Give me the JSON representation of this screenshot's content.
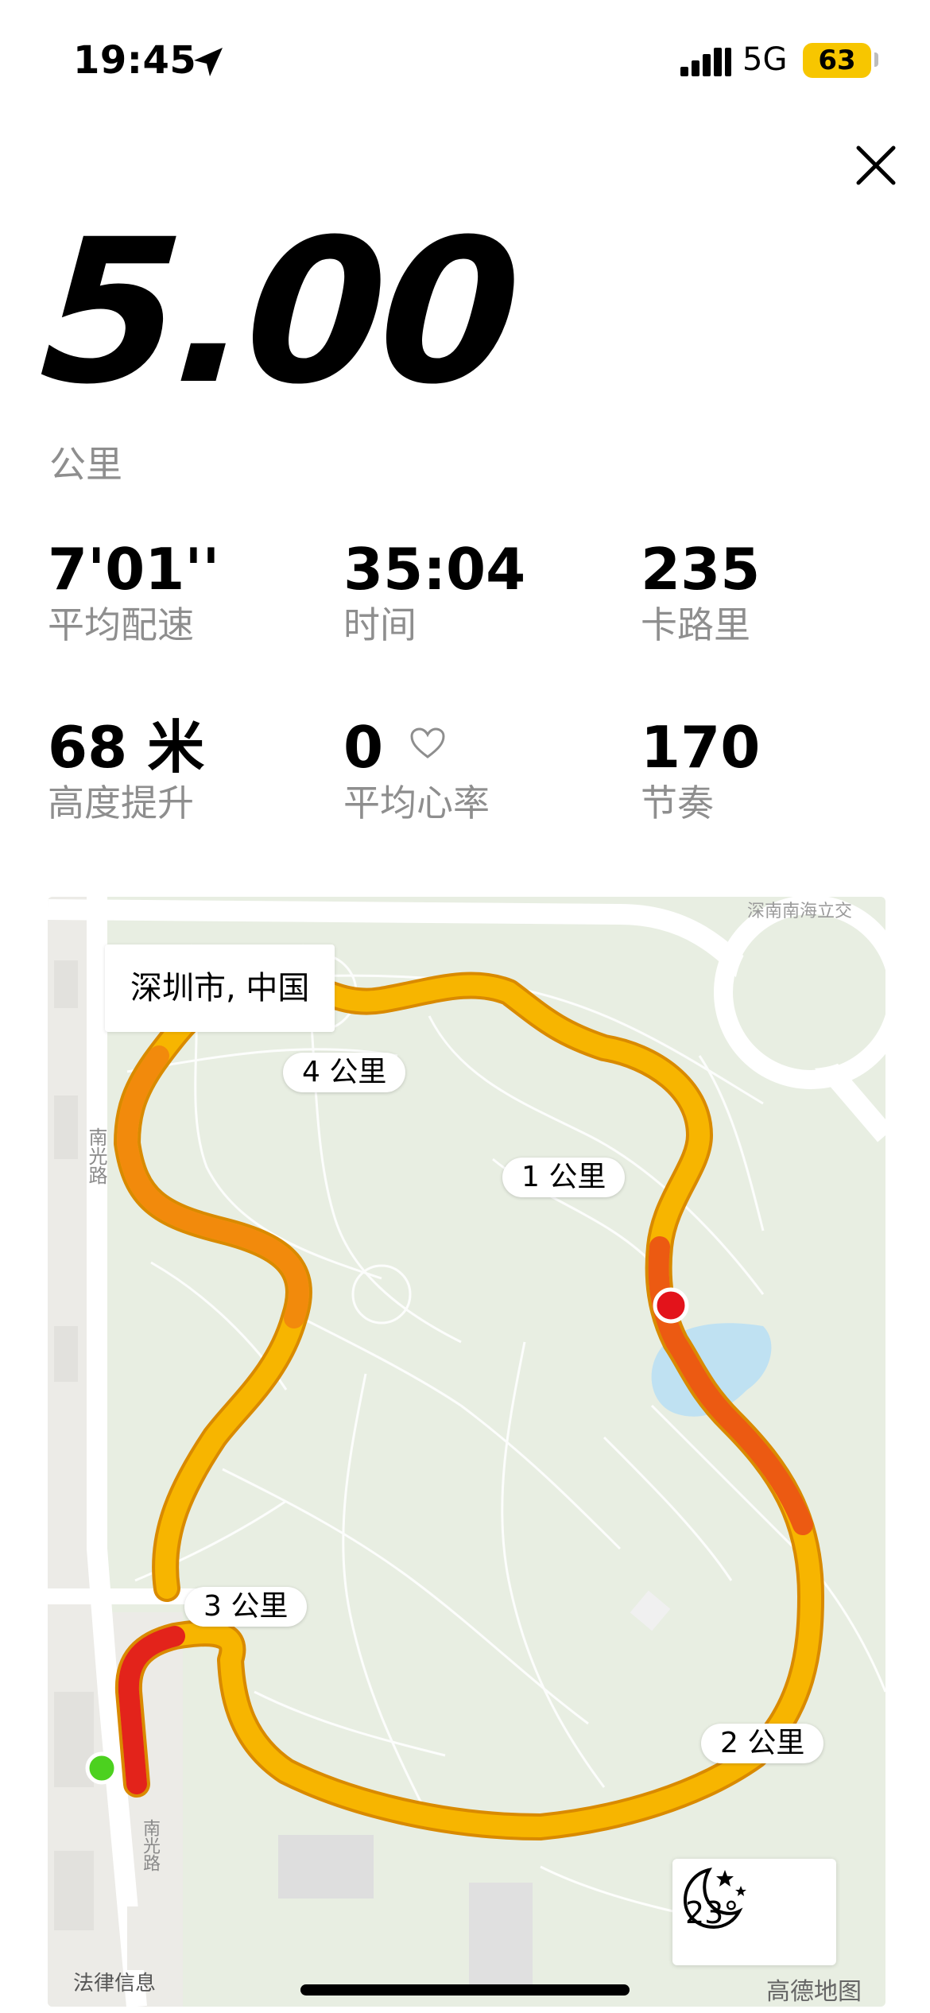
{
  "status_bar": {
    "time": "19:45",
    "network": "5G",
    "battery": "63",
    "battery_color": "#f7c600"
  },
  "summary": {
    "distance": "5.00",
    "distance_unit": "公里"
  },
  "stats": [
    {
      "value": "7'01''",
      "label": "平均配速"
    },
    {
      "value": "35:04",
      "label": "时间"
    },
    {
      "value": "235",
      "label": "卡路里"
    },
    {
      "value": "68 米",
      "label": "高度提升"
    },
    {
      "value": "0",
      "label": "平均心率",
      "icon": "heart-outline-icon"
    },
    {
      "value": "170",
      "label": "节奏"
    }
  ],
  "map": {
    "city": "深圳市, 中国",
    "km_markers": [
      "1 公里",
      "2 公里",
      "3 公里",
      "4 公里"
    ],
    "road_labels": [
      "南光路",
      "南光路",
      "深南南海立交"
    ],
    "weather_temp": "23°",
    "weather_icon": "moon-stars-icon",
    "legal": "法律信息",
    "provider": "高德地图",
    "start_color": "#4cd11f",
    "end_color": "#e3131b",
    "route_colors": [
      "#f9c400",
      "#f7a000",
      "#e8520f"
    ]
  }
}
